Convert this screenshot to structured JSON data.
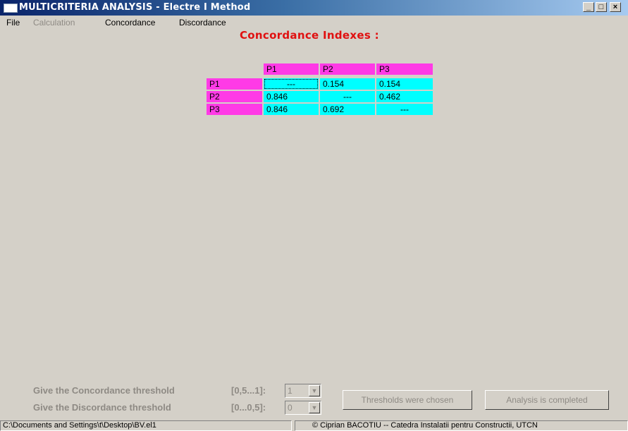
{
  "window": {
    "title": "MULTICRITERIA ANALYSIS - Electre I Method",
    "minimize": "_",
    "maximize": "□",
    "close": "×"
  },
  "menu": {
    "file": "File",
    "calculation": "Calculation",
    "concordance": "Concordance",
    "discordance": "Discordance"
  },
  "heading": "Concordance Indexes :",
  "table": {
    "columns": [
      "P1",
      "P2",
      "P3"
    ],
    "rows": [
      {
        "label": "P1",
        "cells": [
          "---",
          "0.154",
          "0.154"
        ]
      },
      {
        "label": "P2",
        "cells": [
          "0.846",
          "---",
          "0.462"
        ]
      },
      {
        "label": "P3",
        "cells": [
          "0.846",
          "0.692",
          "---"
        ]
      }
    ]
  },
  "colors": {
    "header_bg": "#ff3ae6",
    "cell_bg": "#00ffff",
    "heading": "#e01010"
  },
  "thresholds": {
    "concordance_label": "Give the Concordance threshold",
    "concordance_range": "[0,5...1]:",
    "concordance_value": "1",
    "discordance_label": "Give the Discordance threshold",
    "discordance_range": "[0...0,5]:",
    "discordance_value": "0"
  },
  "buttons": {
    "thresholds_chosen": "Thresholds were chosen",
    "analysis_completed": "Analysis is completed"
  },
  "status": {
    "path": "C:\\Documents and Settings\\t\\Desktop\\BV.el1",
    "copyright": "© Ciprian BACOTIU -- Catedra Instalatii pentru Constructii, UTCN"
  }
}
